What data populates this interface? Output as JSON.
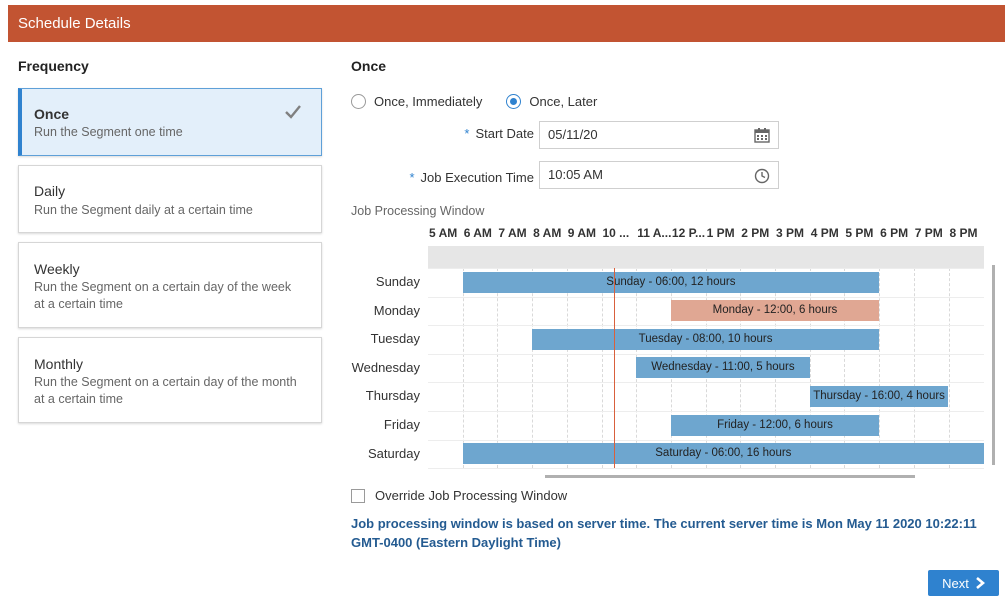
{
  "header": {
    "title": "Schedule Details"
  },
  "frequency": {
    "title": "Frequency",
    "options": [
      {
        "title": "Once",
        "desc": "Run the Segment one time",
        "selected": true
      },
      {
        "title": "Daily",
        "desc": "Run the Segment daily at a certain time",
        "selected": false
      },
      {
        "title": "Weekly",
        "desc": "Run the Segment on a certain day of the week at a certain time",
        "selected": false
      },
      {
        "title": "Monthly",
        "desc": "Run the Segment on a certain day of the month at a certain time",
        "selected": false
      }
    ]
  },
  "once": {
    "title": "Once",
    "radio_immediately": "Once, Immediately",
    "radio_later": "Once, Later",
    "selected_radio": "later",
    "start_date": {
      "label": "Start Date",
      "value": "05/11/20",
      "icon": "calendar-icon"
    },
    "exec_time": {
      "label": "Job Execution Time",
      "value": "10:05 AM",
      "icon": "clock-icon"
    }
  },
  "jpw": {
    "label": "Job Processing Window",
    "hours": [
      "5 AM",
      "6 AM",
      "7 AM",
      "8 AM",
      "9 AM",
      "10 ...",
      "11 A...",
      "12 P...",
      "1 PM",
      "2 PM",
      "3 PM",
      "4 PM",
      "5 PM",
      "6 PM",
      "7 PM",
      "8 PM"
    ],
    "days": [
      "Sunday",
      "Monday",
      "Tuesday",
      "Wednesday",
      "Thursday",
      "Friday",
      "Saturday"
    ],
    "bars": [
      {
        "day": "Sunday",
        "label": "Sunday - 06:00, 12 hours",
        "start": 6,
        "duration": 12,
        "color": "#6ea6cf"
      },
      {
        "day": "Monday",
        "label": "Monday - 12:00, 6 hours",
        "start": 12,
        "duration": 6,
        "color": "#e0a793"
      },
      {
        "day": "Tuesday",
        "label": "Tuesday - 08:00, 10 hours",
        "start": 8,
        "duration": 10,
        "color": "#6ea6cf"
      },
      {
        "day": "Wednesday",
        "label": "Wednesday - 11:00, 5 hours",
        "start": 11,
        "duration": 5,
        "color": "#6ea6cf"
      },
      {
        "day": "Thursday",
        "label": "Thursday - 16:00, 4 hours",
        "start": 16,
        "duration": 4,
        "color": "#6ea6cf"
      },
      {
        "day": "Friday",
        "label": "Friday - 12:00, 6 hours",
        "start": 12,
        "duration": 6,
        "color": "#6ea6cf"
      },
      {
        "day": "Saturday",
        "label": "Saturday - 06:00, 16 hours",
        "start": 6,
        "duration": 16,
        "color": "#6ea6cf"
      }
    ],
    "current_time_hour": 10.37,
    "current_time_color": "#d9603c"
  },
  "override": {
    "label": "Override Job Processing Window",
    "checked": false
  },
  "server_info": "Job processing window is based on server time. The current server time is Mon May 11 2020 10:22:11 GMT-0400 (Eastern Daylight Time)",
  "next_button": {
    "label": "Next",
    "icon": "chevron-right-icon"
  },
  "colors": {
    "header": "#c25432",
    "accent": "#2f82cf",
    "info_text": "#245b91"
  }
}
